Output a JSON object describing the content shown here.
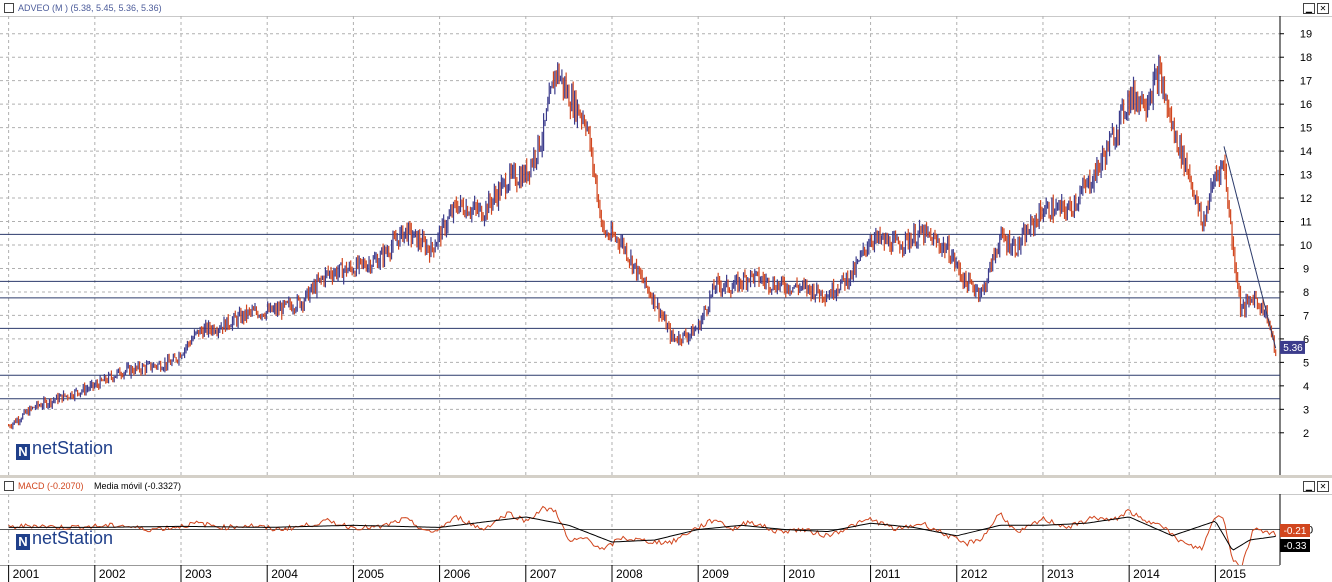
{
  "main_panel": {
    "title": "ADVEO (M ) (5.38, 5.45, 5.36, 5.36)",
    "minimize_icon": "minimize-icon",
    "close_icon": "close-icon",
    "logo_text": "netStation",
    "logo_mark": "N"
  },
  "macd_panel": {
    "title_macd": "MACD (-0.2070)",
    "title_ma": "Media móvil (-0.3327)",
    "logo_text": "netStation",
    "logo_mark": "N"
  },
  "colors": {
    "price_up": "#3c3c8c",
    "price_down": "#d1461e",
    "grid": "#b0b0b0",
    "hline": "#2b3a6b",
    "last_label_bg": "#3c3c8c",
    "macd_badge": "#d1461e",
    "ma_badge": "#000000"
  },
  "chart_data": [
    {
      "type": "line",
      "title": "ADVEO (M )",
      "ylim": [
        0.5,
        19.5
      ],
      "yticks": [
        2,
        3,
        4,
        5,
        6,
        7,
        8,
        9,
        10,
        11,
        12,
        13,
        14,
        15,
        16,
        17,
        18,
        19
      ],
      "x_years": [
        "2001",
        "2002",
        "2003",
        "2004",
        "2005",
        "2006",
        "2007",
        "2008",
        "2009",
        "2010",
        "2011",
        "2012",
        "2013",
        "2014",
        "2015"
      ],
      "series": [
        {
          "x": [
            2001.0,
            2001.3,
            2001.6,
            2002.0,
            2002.3,
            2002.6,
            2002.9,
            2003.2,
            2003.5,
            2003.8,
            2004.1,
            2004.4,
            2004.7,
            2005.0,
            2005.3,
            2005.6,
            2005.9,
            2006.2,
            2006.5,
            2006.8,
            2007.0,
            2007.2,
            2007.35,
            2007.5,
            2007.7,
            2007.9,
            2008.1,
            2008.3,
            2008.5,
            2008.7,
            2008.9,
            2009.0,
            2009.2,
            2009.4,
            2009.6,
            2009.9,
            2010.2,
            2010.5,
            2010.8,
            2011.0,
            2011.3,
            2011.6,
            2011.9,
            2012.1,
            2012.3,
            2012.5,
            2012.7,
            2013.0,
            2013.3,
            2013.6,
            2013.8,
            2014.0,
            2014.2,
            2014.35,
            2014.5,
            2014.7,
            2014.85,
            2015.0,
            2015.1,
            2015.2,
            2015.3,
            2015.45,
            2015.6,
            2015.7
          ],
          "values": [
            2.3,
            3.1,
            3.5,
            4.0,
            4.6,
            4.8,
            5.0,
            6.3,
            6.6,
            7.1,
            7.2,
            7.6,
            8.8,
            9.0,
            9.4,
            10.6,
            9.8,
            11.7,
            11.4,
            12.8,
            13.0,
            14.7,
            17.5,
            16.3,
            15.3,
            10.5,
            10.2,
            8.8,
            7.6,
            6.0,
            6.2,
            6.5,
            8.3,
            8.2,
            8.7,
            8.3,
            8.2,
            7.9,
            8.8,
            10.3,
            10.0,
            10.5,
            9.8,
            8.4,
            8.0,
            10.3,
            9.9,
            11.5,
            11.5,
            13.0,
            14.5,
            16.3,
            16.2,
            17.3,
            15.0,
            13.0,
            10.8,
            13.0,
            13.5,
            10.0,
            7.2,
            7.8,
            7.0,
            5.36
          ]
        }
      ],
      "horizontal_lines": [
        10.45,
        8.45,
        7.75,
        6.45,
        4.45,
        3.45
      ],
      "trendline": {
        "x": [
          2015.1,
          2015.7
        ],
        "y": [
          14.2,
          5.6
        ]
      },
      "last_value_label": "5.36"
    },
    {
      "type": "line",
      "title": "MACD",
      "ylim": [
        -1.6,
        1.6
      ],
      "yticks": [
        0
      ],
      "series": [
        {
          "name": "MACD (-0.2070)",
          "x": [
            2001.0,
            2001.3,
            2001.6,
            2002.0,
            2002.3,
            2002.6,
            2002.9,
            2003.2,
            2003.5,
            2003.8,
            2004.1,
            2004.4,
            2004.7,
            2005.0,
            2005.3,
            2005.6,
            2005.9,
            2006.2,
            2006.5,
            2006.8,
            2007.0,
            2007.2,
            2007.35,
            2007.5,
            2007.7,
            2007.9,
            2008.1,
            2008.3,
            2008.5,
            2008.7,
            2008.9,
            2009.0,
            2009.2,
            2009.4,
            2009.6,
            2009.9,
            2010.2,
            2010.5,
            2010.8,
            2011.0,
            2011.3,
            2011.6,
            2011.9,
            2012.1,
            2012.3,
            2012.5,
            2012.7,
            2013.0,
            2013.3,
            2013.6,
            2013.8,
            2014.0,
            2014.2,
            2014.35,
            2014.5,
            2014.7,
            2014.85,
            2015.0,
            2015.1,
            2015.2,
            2015.3,
            2015.45,
            2015.6,
            2015.7
          ],
          "values": [
            0.1,
            0.2,
            0.1,
            0.15,
            0.2,
            0.0,
            0.1,
            0.3,
            0.1,
            0.2,
            0.0,
            0.15,
            0.4,
            0.1,
            0.1,
            0.5,
            -0.2,
            0.6,
            0.0,
            0.8,
            0.4,
            1.0,
            0.9,
            -0.6,
            -0.4,
            -1.0,
            -0.4,
            -0.5,
            -0.6,
            -0.6,
            -0.1,
            0.1,
            0.5,
            0.0,
            0.4,
            -0.1,
            0.0,
            -0.3,
            0.2,
            0.5,
            0.0,
            0.3,
            -0.3,
            -0.7,
            -0.4,
            0.8,
            -0.2,
            0.5,
            0.1,
            0.6,
            0.4,
            0.9,
            0.3,
            0.4,
            -0.3,
            -0.8,
            -0.9,
            0.7,
            0.5,
            -1.4,
            -1.8,
            0.1,
            -0.1,
            -0.21
          ]
        },
        {
          "name": "Media móvil (-0.3327)",
          "x": [
            2001.0,
            2002.0,
            2003.0,
            2004.0,
            2005.0,
            2006.0,
            2007.0,
            2007.5,
            2008.0,
            2008.5,
            2009.0,
            2009.5,
            2010.0,
            2010.5,
            2011.0,
            2011.5,
            2012.0,
            2012.5,
            2013.0,
            2013.5,
            2014.0,
            2014.5,
            2015.0,
            2015.2,
            2015.4,
            2015.7
          ],
          "values": [
            0.1,
            0.1,
            0.15,
            0.1,
            0.2,
            0.1,
            0.6,
            0.2,
            -0.6,
            -0.5,
            0.0,
            0.2,
            0.0,
            -0.1,
            0.3,
            0.1,
            -0.3,
            0.2,
            0.2,
            0.3,
            0.6,
            -0.3,
            0.4,
            -1.0,
            -0.5,
            -0.33
          ]
        }
      ],
      "last_value_labels": [
        "-0.21",
        "-0.33"
      ]
    }
  ]
}
